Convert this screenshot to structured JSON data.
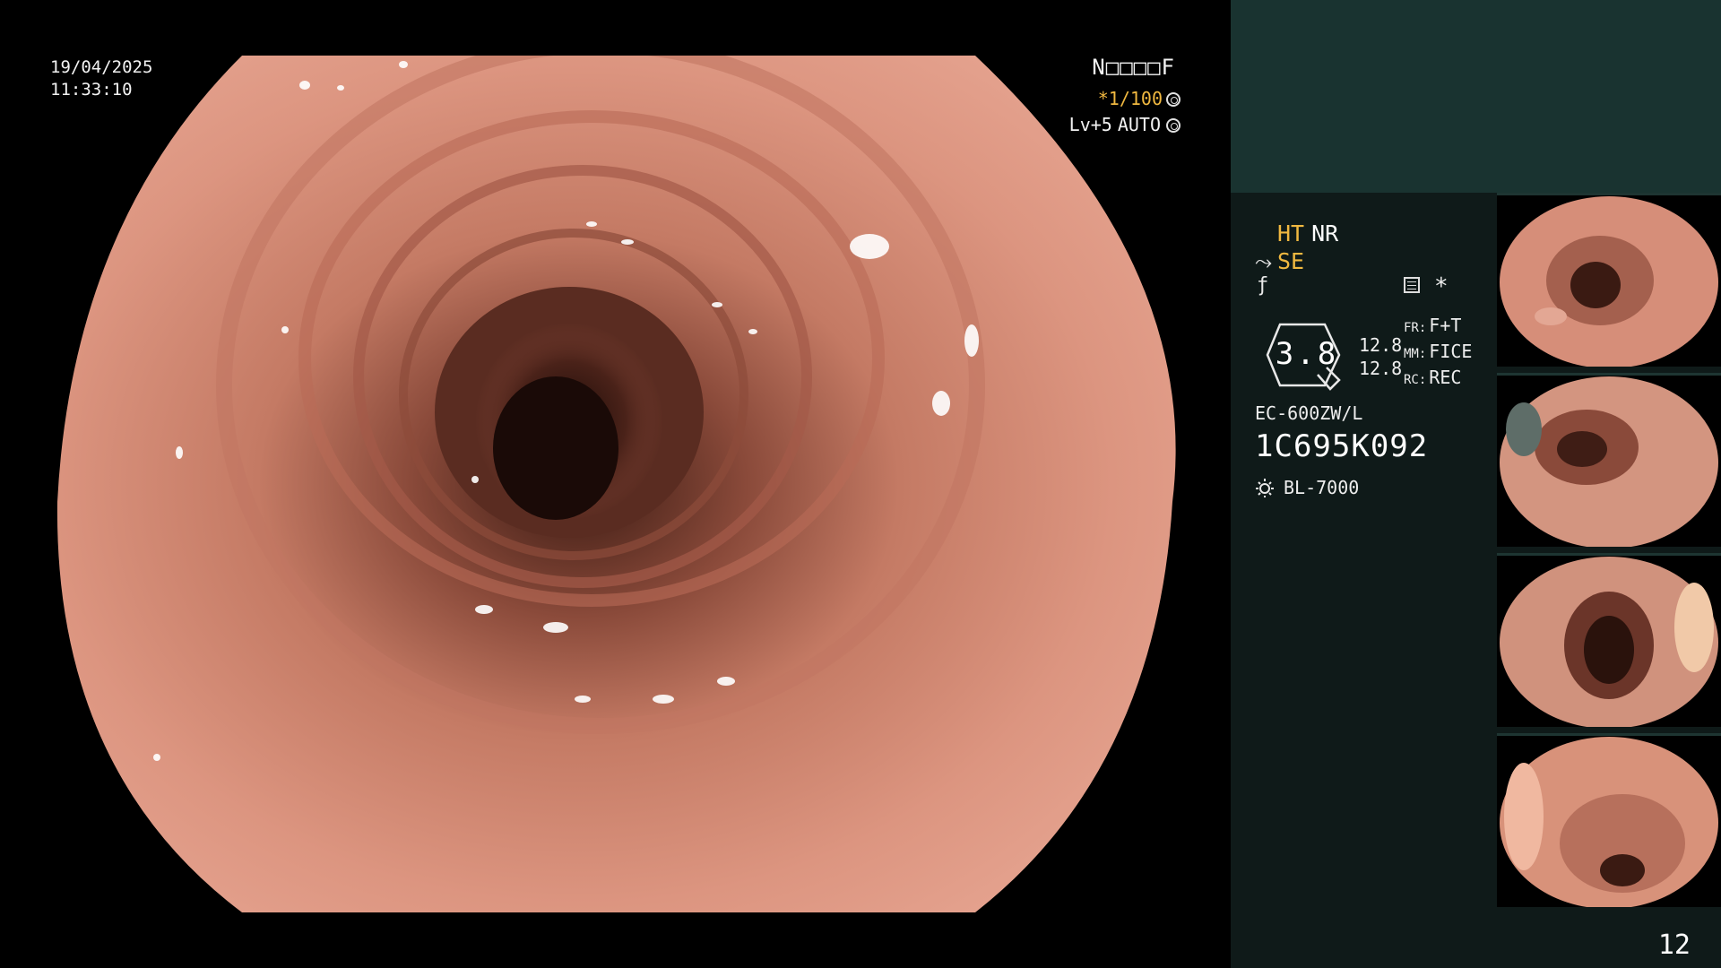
{
  "overlay": {
    "date": "19/04/2025",
    "time": "11:33:10",
    "patient_id": "N□□□□F",
    "shutter": "*1/100",
    "level": "Lv+5",
    "iris": "AUTO"
  },
  "panel": {
    "mode_ht": "HT",
    "mode_nr": "NR",
    "mode_se": "SE",
    "asterisk": "*",
    "zoom_value": "3.8",
    "num_top": "12.8",
    "num_bottom": "12.8",
    "fr_key": "FR:",
    "fr_value": "F+T",
    "mm_key": "MM:",
    "mm_value": "FICE",
    "rc_key": "RC:",
    "rc_value": "REC",
    "scope_model": "EC-600ZW/L",
    "scope_serial": "1C695K092",
    "light_source": "BL-7000",
    "page_number": "12"
  },
  "colors": {
    "side_top": "#193330",
    "side_panel": "#0f1a19",
    "accent_yellow": "#f0b840",
    "mucosa": "#d88a72"
  },
  "icons": [
    "shutter-icon",
    "iris-icon",
    "scope-bend-icon",
    "f-icon",
    "document-icon",
    "zoom-icon",
    "light-source-icon"
  ]
}
